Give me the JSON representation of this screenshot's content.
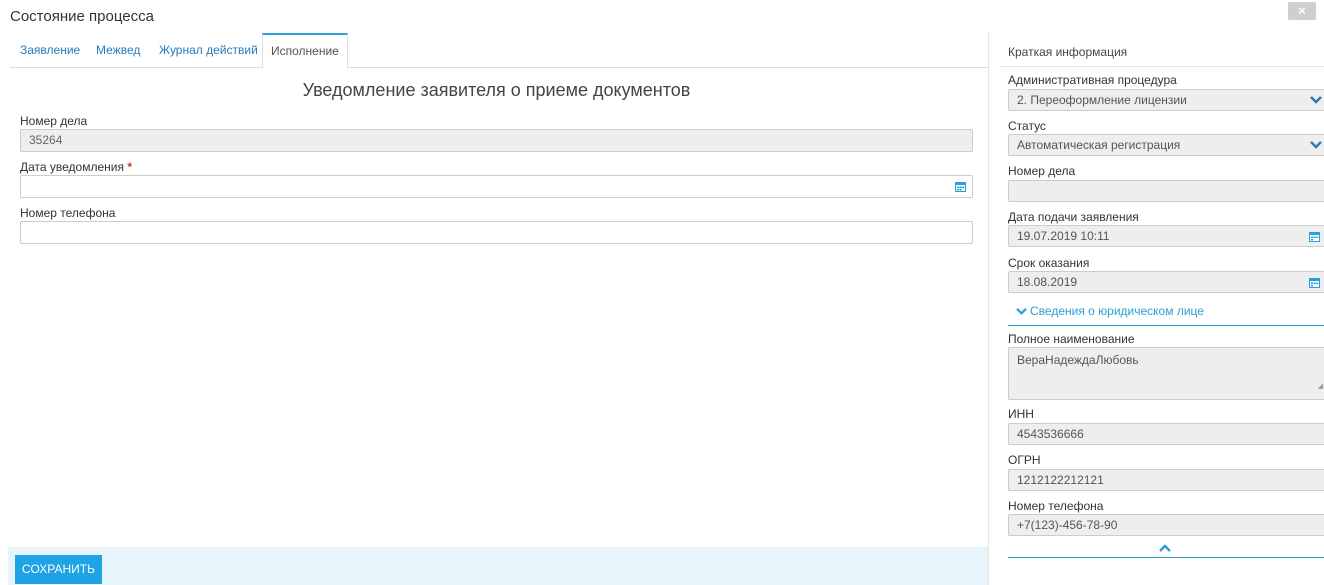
{
  "window": {
    "title": "Состояние процесса",
    "close_label": "×"
  },
  "tabs": [
    {
      "label": "Заявление"
    },
    {
      "label": "Межвед"
    },
    {
      "label": "Журнал действий"
    },
    {
      "label": "Исполнение",
      "active": true
    }
  ],
  "form": {
    "title": "Уведомление заявителя о приеме документов",
    "case_number": {
      "label": "Номер дела",
      "value": "35264"
    },
    "notice_date": {
      "label": "Дата уведомления",
      "required_mark": "*",
      "value": "",
      "icon": "calendar-icon"
    },
    "phone": {
      "label": "Номер телефона",
      "value": ""
    },
    "save_label": "СОХРАНИТЬ"
  },
  "summary": {
    "title": "Краткая информация",
    "procedure": {
      "label": "Административная процедура",
      "value": "2. Переоформление лицензии"
    },
    "status": {
      "label": "Статус",
      "value": "Автоматическая регистрация"
    },
    "case_number": {
      "label": "Номер дела",
      "value": ""
    },
    "filing_date": {
      "label": "Дата подачи заявления",
      "value": "19.07.2019 10:11"
    },
    "deadline": {
      "label": "Срок оказания",
      "value": "18.08.2019"
    },
    "legal_entity_section": "Сведения о юридическом лице",
    "full_name": {
      "label": "Полное наименование",
      "value": "ВераНадеждаЛюбовь"
    },
    "inn": {
      "label": "ИНН",
      "value": "4543536666"
    },
    "ogrn": {
      "label": "ОГРН",
      "value": "1212122212121"
    },
    "phone": {
      "label": "Номер телефона",
      "value": "+7(123)-456-78-90"
    }
  },
  "colors": {
    "accent": "#2a9fd8",
    "button": "#1ea3e6",
    "footer": "#e8f4fb",
    "required": "#d9322a"
  }
}
